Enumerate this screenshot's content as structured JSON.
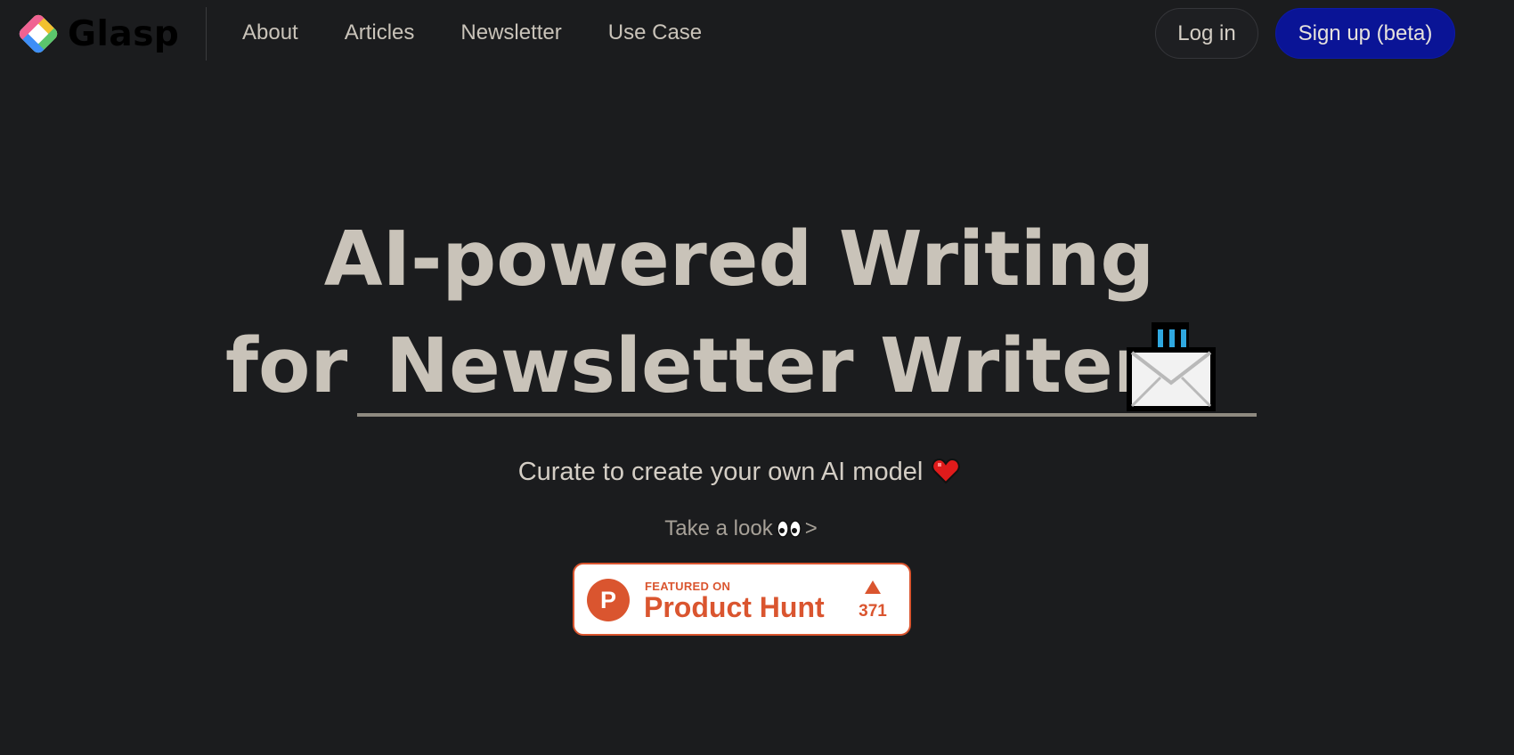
{
  "header": {
    "logo_text": "Glasp",
    "nav": [
      {
        "label": "About"
      },
      {
        "label": "Articles"
      },
      {
        "label": "Newsletter"
      },
      {
        "label": "Use Case"
      }
    ],
    "login_label": "Log in",
    "signup_label": "Sign up (beta)"
  },
  "hero": {
    "line1": "AI-powered Writing",
    "line2_prefix": "for",
    "line2_highlight": "Newsletter Writers",
    "highlight_icon": "incoming-envelope-icon",
    "subtitle": "Curate to create your own AI model",
    "subtitle_icon": "red-heart-icon",
    "take_look": "Take a look",
    "take_look_icon": "eyes-icon",
    "take_look_arrow": ">"
  },
  "product_hunt": {
    "featured_label": "FEATURED ON",
    "name": "Product Hunt",
    "upvotes": "371",
    "logo_letter": "P"
  },
  "colors": {
    "background": "#1b1c1e",
    "text": "#c9c3b9",
    "signup_bg": "#0a1496",
    "product_hunt": "#da552f"
  }
}
